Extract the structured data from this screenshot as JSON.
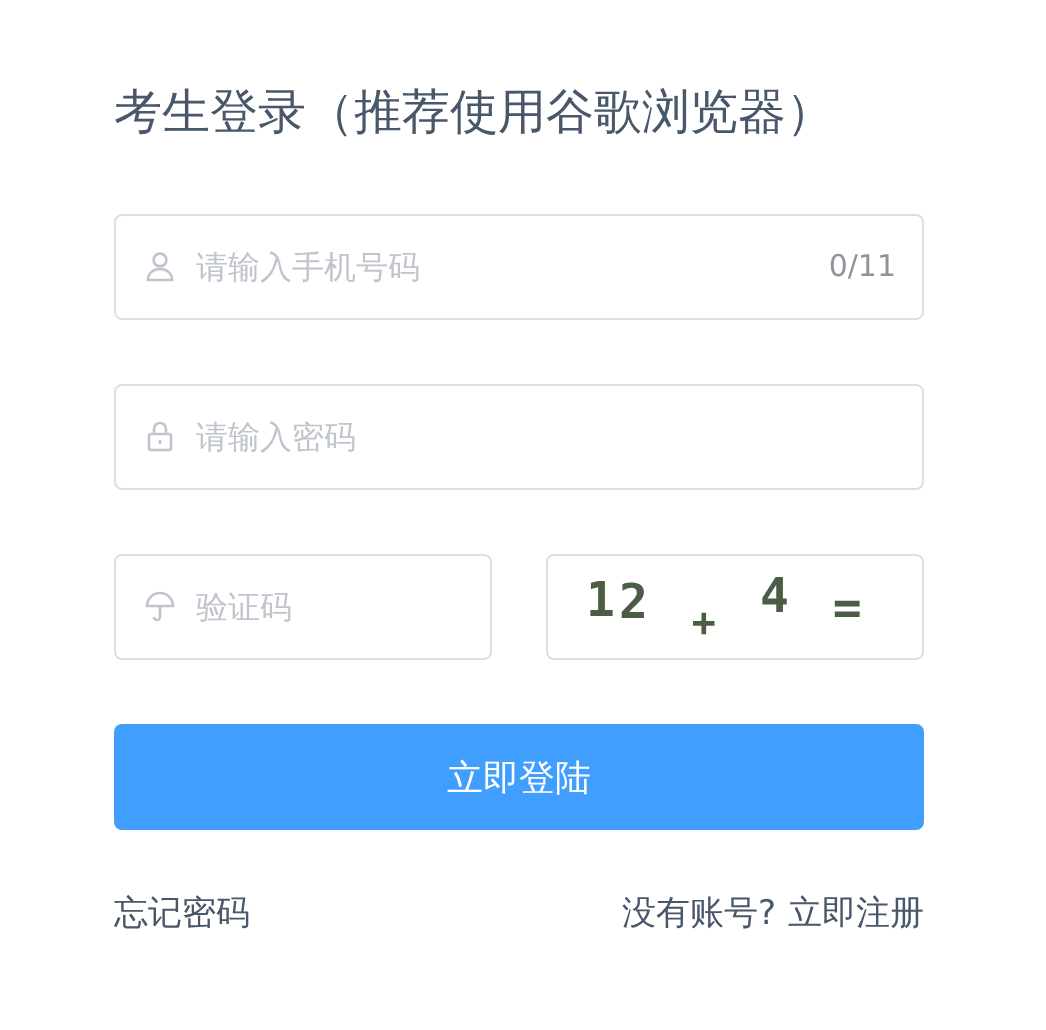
{
  "title": "考生登录（推荐使用谷歌浏览器）",
  "fields": [
    {
      "kind": "phone",
      "placeholder": "请输入手机号码",
      "counter": "0/11"
    },
    {
      "kind": "password",
      "placeholder": "请输入密码"
    }
  ],
  "captcha": {
    "placeholder": "验证码",
    "chars": [
      "1",
      "2",
      "+",
      "4",
      "="
    ]
  },
  "login_button": "立即登陆",
  "forgot_link": "忘记密码",
  "register_prompt": "没有账号?",
  "register_link": "立即注册"
}
